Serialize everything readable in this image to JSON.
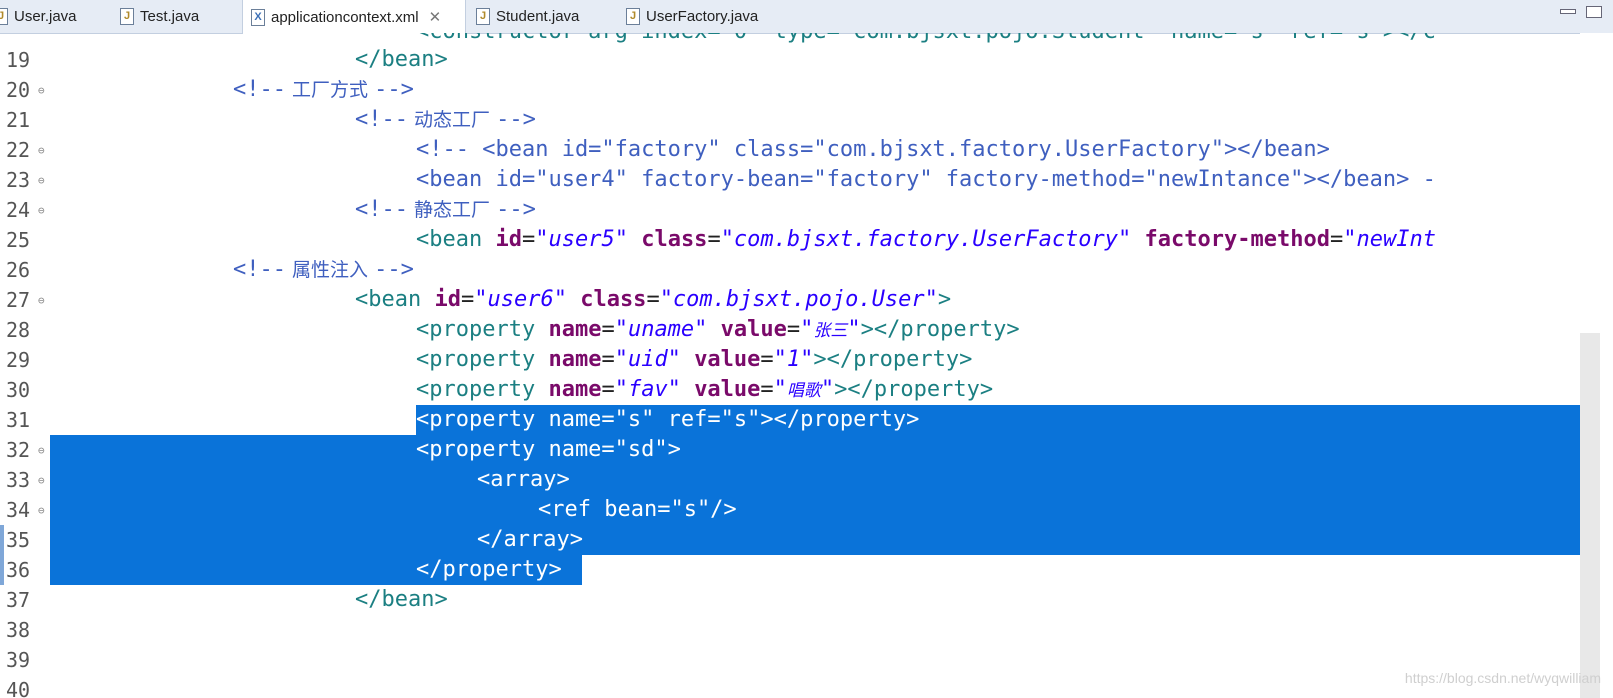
{
  "tabs": [
    {
      "label": "User.java",
      "icon": "java-file-icon"
    },
    {
      "label": "Test.java",
      "icon": "java-file-icon"
    },
    {
      "label": "applicationcontext.xml",
      "icon": "xml-file-icon",
      "close": "✕"
    },
    {
      "label": "Student.java",
      "icon": "java-file-icon"
    },
    {
      "label": "UserFactory.java",
      "icon": "java-file-icon"
    }
  ],
  "window_controls": [
    "minimize-icon",
    "maximize-icon"
  ],
  "editor": {
    "lines": [
      {
        "num": "19"
      },
      {
        "num": "20"
      },
      {
        "num": "21"
      },
      {
        "num": "22"
      },
      {
        "num": "23"
      },
      {
        "num": "24"
      },
      {
        "num": "25"
      },
      {
        "num": "26"
      },
      {
        "num": "27"
      },
      {
        "num": "28"
      },
      {
        "num": "29"
      },
      {
        "num": "30"
      },
      {
        "num": "31"
      },
      {
        "num": "32"
      },
      {
        "num": "33"
      },
      {
        "num": "34"
      },
      {
        "num": "35"
      },
      {
        "num": "36"
      },
      {
        "num": "37"
      },
      {
        "num": "38"
      },
      {
        "num": "39"
      },
      {
        "num": "40"
      }
    ],
    "top_partial_line": "<constructor-arg index=\"0\" type=\"com.bjsxt.pojo.Student\" name=\"s\" ref=\"s\"></c",
    "code": {
      "l19": "</bean>",
      "l20_open": "<!--",
      "l20_text": " 工厂方式 ",
      "l20_close": "-->",
      "l21_open": "<!--",
      "l21_text": " 动态工厂 ",
      "l21_close": "-->",
      "l22": "<!-- <bean id=\"factory\" class=\"com.bjsxt.factory.UserFactory\"></bean>",
      "l23": "<bean id=\"user4\" factory-bean=\"factory\" factory-method=\"newIntance\"></bean> -",
      "l24_open": "<!--",
      "l24_text": " 静态工厂 ",
      "l24_close": "-->",
      "l25_tag": "<bean",
      "l25_a1": "id",
      "l25_v1": "\"user5\"",
      "l25_a2": "class",
      "l25_v2": "\"com.bjsxt.factory.UserFactory\"",
      "l25_a3": "factory-method",
      "l25_v3": "\"newInt",
      "l26_open": "<!--",
      "l26_text": " 属性注入 ",
      "l26_close": "-->",
      "l27_tag": "<bean",
      "l27_a1": "id",
      "l27_v1": "\"user6\"",
      "l27_a2": "class",
      "l27_v2": "\"com.bjsxt.pojo.User\"",
      "l27_end": ">",
      "prop_tag": "<property",
      "prop_name": "name",
      "prop_value": "value",
      "prop_end": "></property>",
      "l28_v1": "\"uname\"",
      "l28_v2q1": "\"",
      "l28_v2": "张三",
      "l28_v2q2": "\"",
      "l29_v1": "\"uid\"",
      "l29_v2": "\"1\"",
      "l30_v1": "\"fav\"",
      "l30_v2q1": "\"",
      "l30_v2": "唱歌",
      "l30_v2q2": "\"",
      "l31": "<property name=\"s\" ref=\"s\"></property>",
      "l32": "<property name=\"sd\">",
      "l33": "<array>",
      "l34": "<ref bean=\"s\"/>",
      "l35": "</array>",
      "l36": "</property>",
      "l37": "</bean>",
      "eq": "="
    }
  },
  "watermark": "https://blog.csdn.net/wyqwilliam",
  "colors": {
    "selection": "#0a73d9",
    "tag": "#1b7f82",
    "attribute": "#7a0a6a",
    "value": "#2a00ff",
    "comment": "#3f5fbf"
  }
}
